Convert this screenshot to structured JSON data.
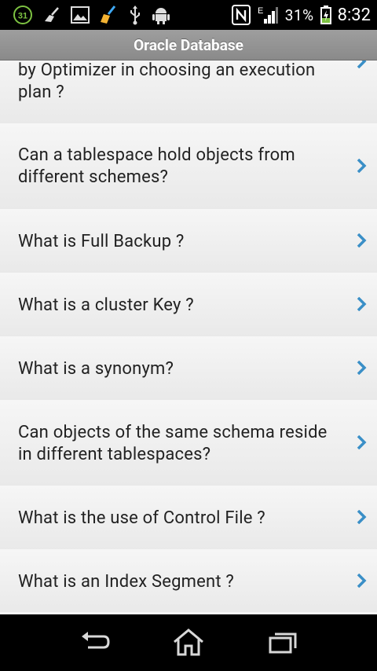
{
  "status_bar": {
    "battery_percent": "31%",
    "time": "8:32",
    "notification_badge": "31",
    "network_type": "E"
  },
  "header": {
    "title": "Oracle Database"
  },
  "list": {
    "items": [
      {
        "text": "by Optimizer in choosing an execution\nplan ?"
      },
      {
        "text": "Can a tablespace hold objects from\ndifferent schemes?"
      },
      {
        "text": "What is Full Backup ?"
      },
      {
        "text": "What is a cluster Key ?"
      },
      {
        "text": "What is a synonym?"
      },
      {
        "text": "Can objects of the same schema reside\nin different tablespaces?"
      },
      {
        "text": "What is the use of Control File ?"
      },
      {
        "text": "What is an Index Segment ?"
      }
    ]
  },
  "navbar": {
    "back": "back-icon",
    "home": "home-icon",
    "recents": "recent-apps-icon"
  },
  "colors": {
    "chevron": "#3a8fc7",
    "title_bar": "#939393"
  }
}
